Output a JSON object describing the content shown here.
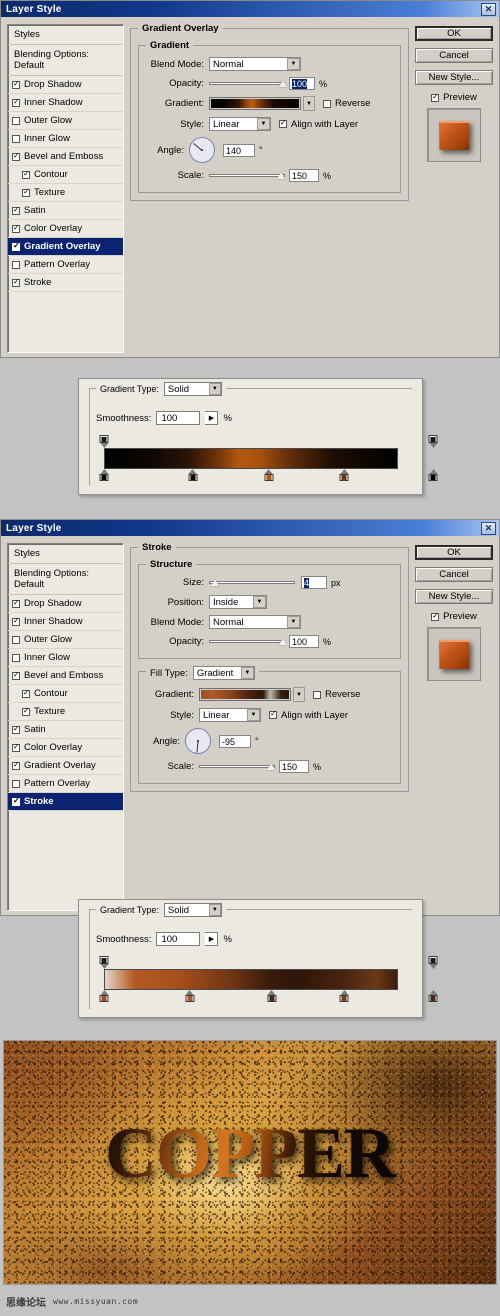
{
  "app": {
    "window_title": "Layer Style",
    "close_icon": "✕"
  },
  "styles_list": {
    "header": "Styles",
    "blending_options": "Blending Options: Default",
    "items": [
      {
        "label": "Drop Shadow",
        "checked": true,
        "sub": false
      },
      {
        "label": "Inner Shadow",
        "checked": true,
        "sub": false
      },
      {
        "label": "Outer Glow",
        "checked": false,
        "sub": false
      },
      {
        "label": "Inner Glow",
        "checked": false,
        "sub": false
      },
      {
        "label": "Bevel and Emboss",
        "checked": true,
        "sub": false
      },
      {
        "label": "Contour",
        "checked": true,
        "sub": true
      },
      {
        "label": "Texture",
        "checked": true,
        "sub": true
      },
      {
        "label": "Satin",
        "checked": true,
        "sub": false
      },
      {
        "label": "Color Overlay",
        "checked": true,
        "sub": false
      },
      {
        "label": "Gradient Overlay",
        "checked": true,
        "sub": false
      },
      {
        "label": "Pattern Overlay",
        "checked": false,
        "sub": false
      },
      {
        "label": "Stroke",
        "checked": true,
        "sub": false
      }
    ]
  },
  "buttons": {
    "ok": "OK",
    "cancel": "Cancel",
    "new_style": "New Style...",
    "preview_label": "Preview",
    "preview_checked": true
  },
  "dialog1": {
    "title": "Layer Style",
    "selected_style": "Gradient Overlay",
    "panel_legend": "Gradient Overlay",
    "section_legend": "Gradient",
    "fields": {
      "blend_mode_label": "Blend Mode:",
      "blend_mode_value": "Normal",
      "opacity_label": "Opacity:",
      "opacity_value": "100",
      "opacity_unit": "%",
      "gradient_label": "Gradient:",
      "reverse_label": "Reverse",
      "reverse_checked": false,
      "style_label": "Style:",
      "style_value": "Linear",
      "align_label": "Align with Layer",
      "align_checked": true,
      "angle_label": "Angle:",
      "angle_value": "140",
      "angle_unit": "°",
      "scale_label": "Scale:",
      "scale_value": "150",
      "scale_unit": "%"
    }
  },
  "dialog2": {
    "title": "Layer Style",
    "selected_style": "Stroke",
    "panel_legend": "Stroke",
    "section_legend": "Structure",
    "fields": {
      "size_label": "Size:",
      "size_value": "4",
      "size_unit": "px",
      "position_label": "Position:",
      "position_value": "Inside",
      "blend_mode_label": "Blend Mode:",
      "blend_mode_value": "Normal",
      "opacity_label": "Opacity:",
      "opacity_value": "100",
      "opacity_unit": "%",
      "fill_type_label": "Fill Type:",
      "fill_type_value": "Gradient",
      "gradient_label": "Gradient:",
      "reverse_label": "Reverse",
      "reverse_checked": false,
      "style_label": "Style:",
      "style_value": "Linear",
      "align_label": "Align with Layer",
      "align_checked": true,
      "angle_label": "Angle:",
      "angle_value": "-95",
      "angle_unit": "°",
      "scale_label": "Scale:",
      "scale_value": "150",
      "scale_unit": "%"
    }
  },
  "gradient_editor_1": {
    "type_label": "Gradient Type:",
    "type_value": "Solid",
    "smoothness_label": "Smoothness:",
    "smoothness_value": "100",
    "smoothness_unit": "%",
    "css": "linear-gradient(to right,#000000 0%,#0a0603 14%,#291306 28%,#6b3208 38%,#b2590f 46%,#a55210 53%,#5d2c09 64%,#1d0d04 78%,#000000 100%)",
    "opacity_stops": [
      {
        "pos": 0
      },
      {
        "pos": 100
      }
    ],
    "color_stops": [
      {
        "pos": 0,
        "color": "#000000"
      },
      {
        "pos": 27,
        "color": "#120a05"
      },
      {
        "pos": 50,
        "color": "#b25b10"
      },
      {
        "pos": 73,
        "color": "#6b3a14"
      },
      {
        "pos": 100,
        "color": "#000000"
      }
    ]
  },
  "gradient_editor_2": {
    "type_label": "Gradient Type:",
    "type_value": "Solid",
    "smoothness_label": "Smoothness:",
    "smoothness_value": "100",
    "smoothness_unit": "%",
    "css": "linear-gradient(to right,#9b4a1e 0%,#b4572020 0%,#b35a22 10%,#a7501d 25%,#6e3414 44%,#3a1c0c 56%,#2e1609 66%,#4a2410 82%,#6b3818 93%,#3c1d0c 100%)",
    "opacity_stops": [
      {
        "pos": 0
      },
      {
        "pos": 100
      }
    ],
    "color_stops": [
      {
        "pos": 0,
        "color": "#a04c1e"
      },
      {
        "pos": 26,
        "color": "#b4572a"
      },
      {
        "pos": 51,
        "color": "#4a2412"
      },
      {
        "pos": 73,
        "color": "#7a3b18"
      },
      {
        "pos": 100,
        "color": "#4a2210"
      }
    ]
  },
  "gradient_swatch_1": "linear-gradient(to right,#000000 0%,#0b0604 18%,#331808 32%,#9c4b0d 42%,#b8600f 47%,#79390b 55%,#1a0c04 70%,#000000 100%)",
  "gradient_swatch_2": "linear-gradient(to right,#9e4a1e 0%,#b05a26 14%,#8c4319 34%,#4a2411 54%,#2e1608 70%,#26120722 78%,#3a1c0d 90%,#2a1408 100%)",
  "artwork": {
    "title_text": "COPPER",
    "accent_color": "#c2681a"
  },
  "watermark": {
    "forum": "思缘论坛",
    "url": "www.missyuan.com"
  }
}
